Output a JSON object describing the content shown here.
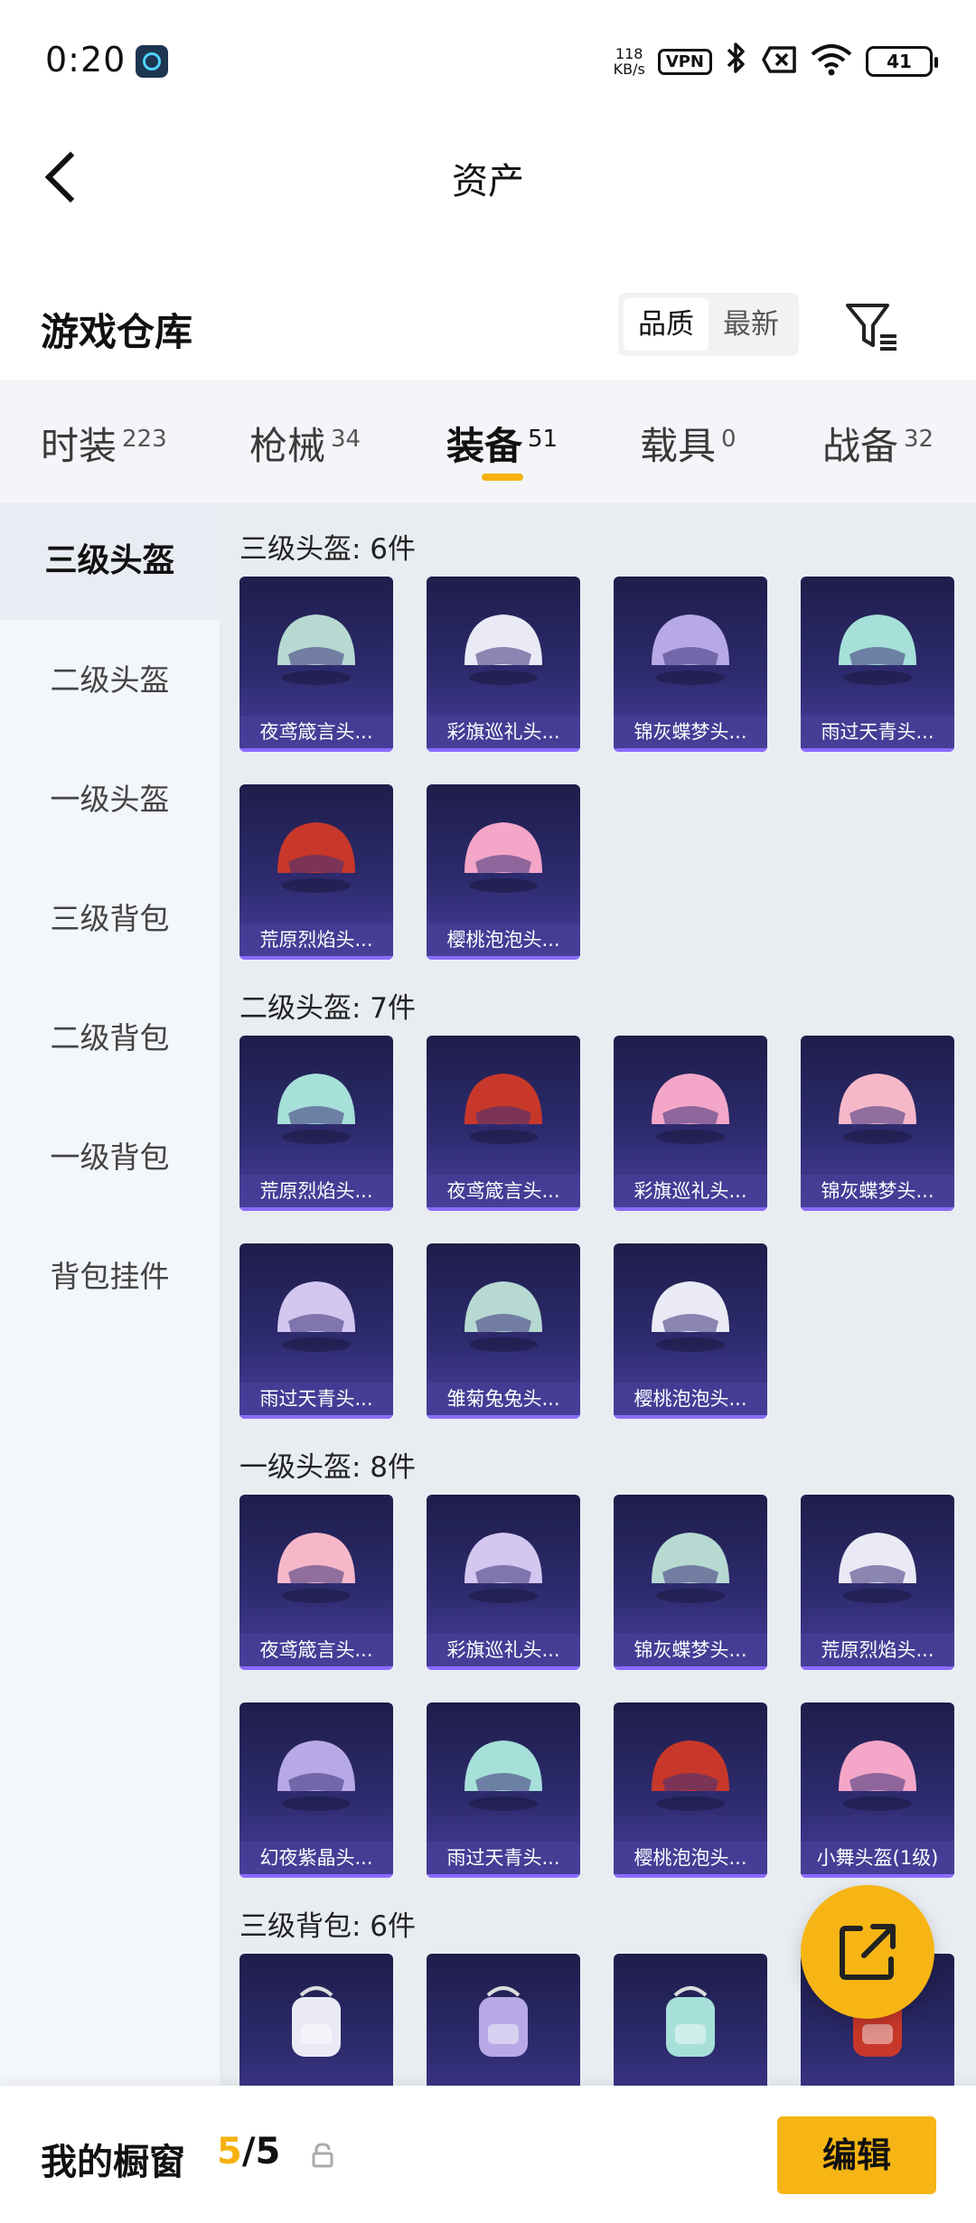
{
  "status_bar": {
    "time": "0:20",
    "speed_value": "118",
    "speed_unit": "KB/s",
    "vpn": "VPN",
    "bluetooth_icon": "bluetooth-icon",
    "no_sim_icon": "no-sim-icon",
    "wifi_icon": "wifi-icon",
    "battery": "41"
  },
  "nav": {
    "title": "资产"
  },
  "header": {
    "title": "游戏仓库",
    "sort_options": [
      "品质",
      "最新"
    ],
    "sort_selected": "品质"
  },
  "tabs": [
    {
      "label": "时装",
      "count": "223"
    },
    {
      "label": "枪械",
      "count": "34"
    },
    {
      "label": "装备",
      "count": "51"
    },
    {
      "label": "载具",
      "count": "0"
    },
    {
      "label": "战备",
      "count": "32"
    }
  ],
  "active_tab": "装备",
  "sidebar": {
    "items": [
      "三级头盔",
      "二级头盔",
      "一级头盔",
      "三级背包",
      "二级背包",
      "一级背包",
      "背包挂件"
    ],
    "active": "三级头盔"
  },
  "groups": [
    {
      "title": "三级头盔: 6件",
      "items": [
        {
          "name": "夜鸢箴言头...",
          "art": "helmet"
        },
        {
          "name": "彩旗巡礼头...",
          "art": "helmet"
        },
        {
          "name": "锦灰蝶梦头...",
          "art": "helmet"
        },
        {
          "name": "雨过天青头...",
          "art": "helmet"
        },
        {
          "name": "荒原烈焰头...",
          "art": "helmet"
        },
        {
          "name": "樱桃泡泡头...",
          "art": "helmet"
        }
      ]
    },
    {
      "title": "二级头盔: 7件",
      "items": [
        {
          "name": "荒原烈焰头...",
          "art": "helmet"
        },
        {
          "name": "夜鸢箴言头...",
          "art": "helmet"
        },
        {
          "name": "彩旗巡礼头...",
          "art": "helmet"
        },
        {
          "name": "锦灰蝶梦头...",
          "art": "helmet"
        },
        {
          "name": "雨过天青头...",
          "art": "helmet"
        },
        {
          "name": "雏菊兔兔头...",
          "art": "helmet"
        },
        {
          "name": "樱桃泡泡头...",
          "art": "helmet"
        }
      ]
    },
    {
      "title": "一级头盔: 8件",
      "items": [
        {
          "name": "夜鸢箴言头...",
          "art": "helmet"
        },
        {
          "name": "彩旗巡礼头...",
          "art": "helmet"
        },
        {
          "name": "锦灰蝶梦头...",
          "art": "helmet"
        },
        {
          "name": "荒原烈焰头...",
          "art": "helmet"
        },
        {
          "name": "幻夜紫晶头...",
          "art": "helmet"
        },
        {
          "name": "雨过天青头...",
          "art": "helmet"
        },
        {
          "name": "樱桃泡泡头...",
          "art": "helmet"
        },
        {
          "name": "小舞头盔(1级)",
          "art": "helmet"
        }
      ]
    },
    {
      "title": "三级背包: 6件",
      "items": [
        {
          "name": "",
          "art": "backpack"
        },
        {
          "name": "",
          "art": "backpack"
        },
        {
          "name": "",
          "art": "backpack"
        },
        {
          "name": "",
          "art": "backpack"
        }
      ]
    }
  ],
  "fab": {
    "icon": "share-export-icon"
  },
  "bottom": {
    "title": "我的橱窗",
    "count_current": "5",
    "count_sep": "/",
    "count_total": "5",
    "lock_icon": "lock-icon",
    "edit_label": "编辑"
  },
  "colors": {
    "accent": "#f5b10d",
    "card_top": "#1e1d4a",
    "card_bottom": "#4a3ea0",
    "sidebar_bg": "#f3f6fa",
    "main_bg": "#e9edf2"
  }
}
